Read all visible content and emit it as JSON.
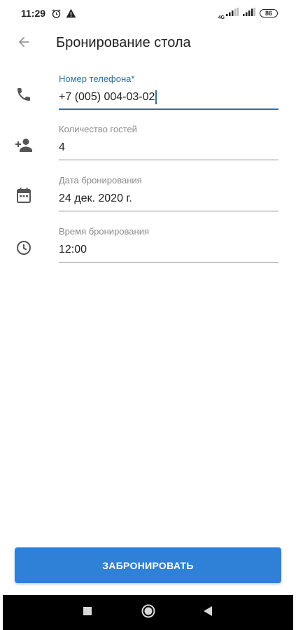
{
  "status_bar": {
    "time": "11:29",
    "network": "4G",
    "battery": "86"
  },
  "app_bar": {
    "title": "Бронирование стола"
  },
  "form": {
    "phone": {
      "label": "Номер телефона*",
      "value": "+7 (005) 004-03-02"
    },
    "guests": {
      "label": "Количество гостей",
      "value": "4"
    },
    "date": {
      "label": "Дата бронирования",
      "value": "24 дек. 2020 г."
    },
    "time": {
      "label": "Время бронирования",
      "value": "12:00"
    }
  },
  "actions": {
    "book_label": "ЗАБРОНИРОВАТЬ"
  },
  "colors": {
    "accent": "#2e6e9e",
    "button": "#2f80d7",
    "icon": "#555555"
  },
  "icons": {
    "back": "arrow-left-icon",
    "phone": "phone-icon",
    "guests": "person-add-icon",
    "date": "calendar-icon",
    "time": "clock-icon"
  }
}
